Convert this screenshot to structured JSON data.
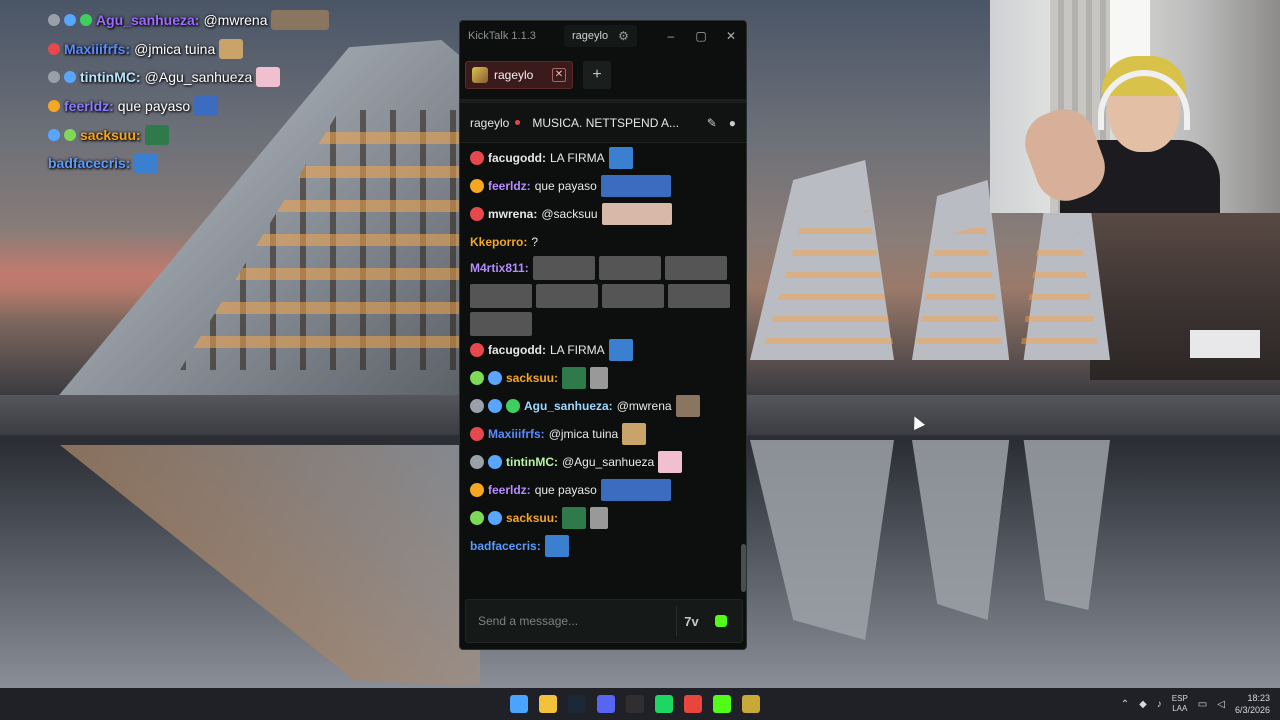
{
  "overlay_chat": [
    {
      "user": "Agu_sanhueza",
      "sep": ":",
      "text": "@mwrena",
      "user_color": "#9d6bff",
      "badges": [
        "#9aa0a8",
        "#58a6ff",
        "#3fcf5f"
      ],
      "emote": "#8a7660"
    },
    {
      "user": "Maxiiifrfs",
      "sep": ":",
      "text": "@jmica tuina",
      "user_color": "#5a8bff",
      "badges": [
        "#e5484d"
      ],
      "emote": "#c9a36a"
    },
    {
      "user": "tintinMC",
      "sep": ":",
      "text": "@Agu_sanhueza",
      "user_color": "#b7e5ff",
      "badges": [
        "#9aa0a8",
        "#58a6ff"
      ],
      "emote": "#f0c0d0"
    },
    {
      "user": "feerldz",
      "sep": ":",
      "text": "que payaso",
      "user_color": "#8a7dff",
      "badges": [
        "#f5a623"
      ],
      "emote": "#3b6cc0"
    },
    {
      "user": "sacksuu",
      "sep": ":",
      "text": "",
      "user_color": "#f5a623",
      "badges": [
        "#58a6ff",
        "#7ed957"
      ],
      "emote": "#2f7a4a"
    },
    {
      "user": "badfacecris",
      "sep": ":",
      "text": "",
      "user_color": "#5a9bff",
      "badges": [],
      "emote": "#3a7fd0"
    }
  ],
  "window": {
    "app_title": "KickTalk 1.1.3",
    "user": "rageylo",
    "gear_icon": "gear-icon",
    "minimize": "–",
    "maximize": "▢",
    "close": "✕"
  },
  "tabs": [
    {
      "label": "rageylo",
      "close": "✕"
    }
  ],
  "add_tab_label": "+",
  "channel": {
    "name": "rageylo",
    "stream_title": "MUSICA. NETTSPEND A..."
  },
  "messages": [
    {
      "user": "facugodd",
      "text": "LA FIRMA",
      "user_color": "#e6e8e7",
      "badges": [
        "#e5484d"
      ],
      "emotes": [
        "#3a7fd0"
      ]
    },
    {
      "user": "feerldz",
      "text": "que payaso",
      "user_color": "#b48cff",
      "badges": [
        "#f5a623"
      ],
      "emotes": [
        "#3b6cc0"
      ]
    },
    {
      "user": "mwrena",
      "text": "@sacksuu",
      "user_color": "#e6e8e7",
      "badges": [
        "#e5484d"
      ],
      "emotes": [
        "#d8b8a8"
      ]
    },
    {
      "user": "Kkeporro",
      "text": "?",
      "user_color": "#f5a623",
      "badges": [],
      "emotes": []
    },
    {
      "user": "M4rtix811",
      "text": "",
      "user_color": "#b48cff",
      "badges": [],
      "emotes": [
        "#555",
        "#555",
        "#555",
        "#555",
        "#555",
        "#555",
        "#555",
        "#555"
      ]
    },
    {
      "user": "facugodd",
      "text": "LA FIRMA",
      "user_color": "#e6e8e7",
      "badges": [
        "#e5484d"
      ],
      "emotes": [
        "#3a7fd0"
      ]
    },
    {
      "user": "sacksuu",
      "text": "",
      "user_color": "#f5a623",
      "badges": [
        "#7ed957",
        "#58a6ff"
      ],
      "emotes": [
        "#2f7a4a",
        "#999"
      ]
    },
    {
      "user": "Agu_sanhueza",
      "text": "@mwrena",
      "user_color": "#9dd8ff",
      "badges": [
        "#9aa0a8",
        "#58a6ff",
        "#3fcf5f"
      ],
      "emotes": [
        "#8a7660"
      ]
    },
    {
      "user": "Maxiiifrfs",
      "text": "@jmica tuina",
      "user_color": "#5a8bff",
      "badges": [
        "#e5484d"
      ],
      "emotes": [
        "#c9a36a"
      ]
    },
    {
      "user": "tintinMC",
      "text": "@Agu_sanhueza",
      "user_color": "#b7f5a6",
      "badges": [
        "#9aa0a8",
        "#58a6ff"
      ],
      "emotes": [
        "#f0c0d0"
      ]
    },
    {
      "user": "feerldz",
      "text": "que payaso",
      "user_color": "#b48cff",
      "badges": [
        "#f5a623"
      ],
      "emotes": [
        "#3b6cc0"
      ]
    },
    {
      "user": "sacksuu",
      "text": "",
      "user_color": "#f5a623",
      "badges": [
        "#7ed957",
        "#58a6ff"
      ],
      "emotes": [
        "#2f7a4a",
        "#999"
      ]
    },
    {
      "user": "badfacecris",
      "text": "",
      "user_color": "#5a9bff",
      "badges": [],
      "emotes": [
        "#3a7fd0"
      ]
    }
  ],
  "input": {
    "placeholder": "Send a message...",
    "emote_button": "7v",
    "kick_emote_icon": "kick-logo-icon"
  },
  "taskbar": {
    "apps": [
      {
        "name": "windows-start-icon",
        "color": "#4aa3ff"
      },
      {
        "name": "file-explorer-icon",
        "color": "#f2c23a"
      },
      {
        "name": "steam-icon",
        "color": "#1b2838"
      },
      {
        "name": "discord-icon",
        "color": "#5865f2"
      },
      {
        "name": "obs-icon",
        "color": "#302e31"
      },
      {
        "name": "spotify-icon",
        "color": "#1ed760"
      },
      {
        "name": "chrome-icon",
        "color": "#e8453c"
      },
      {
        "name": "kick-icon",
        "color": "#53fc18"
      },
      {
        "name": "app-icon",
        "color": "#c9a83a"
      }
    ],
    "lang_top": "ESP",
    "lang_bottom": "LAA",
    "time": "18:23",
    "date": "6/3/2026"
  }
}
